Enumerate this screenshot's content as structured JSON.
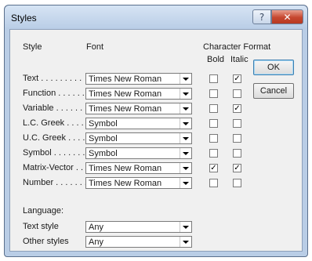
{
  "window": {
    "title": "Styles",
    "help_glyph": "?",
    "close_glyph": "✕"
  },
  "headers": {
    "style": "Style",
    "font": "Font",
    "char_format": "Character Format",
    "bold": "Bold",
    "italic": "Italic"
  },
  "styles": [
    {
      "label": "Text . . . . . . . . .",
      "font": "Times New Roman",
      "bold": false,
      "italic": true
    },
    {
      "label": "Function . . . . . .",
      "font": "Times New Roman",
      "bold": false,
      "italic": false
    },
    {
      "label": "Variable . . . . . .",
      "font": "Times New Roman",
      "bold": false,
      "italic": true
    },
    {
      "label": "L.C. Greek . . . . .",
      "font": "Symbol",
      "bold": false,
      "italic": false
    },
    {
      "label": "U.C. Greek . . . . .",
      "font": "Symbol",
      "bold": false,
      "italic": false
    },
    {
      "label": "Symbol . . . . . . .",
      "font": "Symbol",
      "bold": false,
      "italic": false
    },
    {
      "label": "Matrix-Vector . . . .",
      "font": "Times New Roman",
      "bold": true,
      "italic": true
    },
    {
      "label": "Number . . . . . . .",
      "font": "Times New Roman",
      "bold": false,
      "italic": false
    }
  ],
  "language": {
    "heading": "Language:",
    "rows": [
      {
        "label": "Text style",
        "value": "Any"
      },
      {
        "label": "Other styles",
        "value": "Any"
      }
    ]
  },
  "buttons": {
    "ok": "OK",
    "cancel": "Cancel"
  },
  "check_glyph": "✓"
}
